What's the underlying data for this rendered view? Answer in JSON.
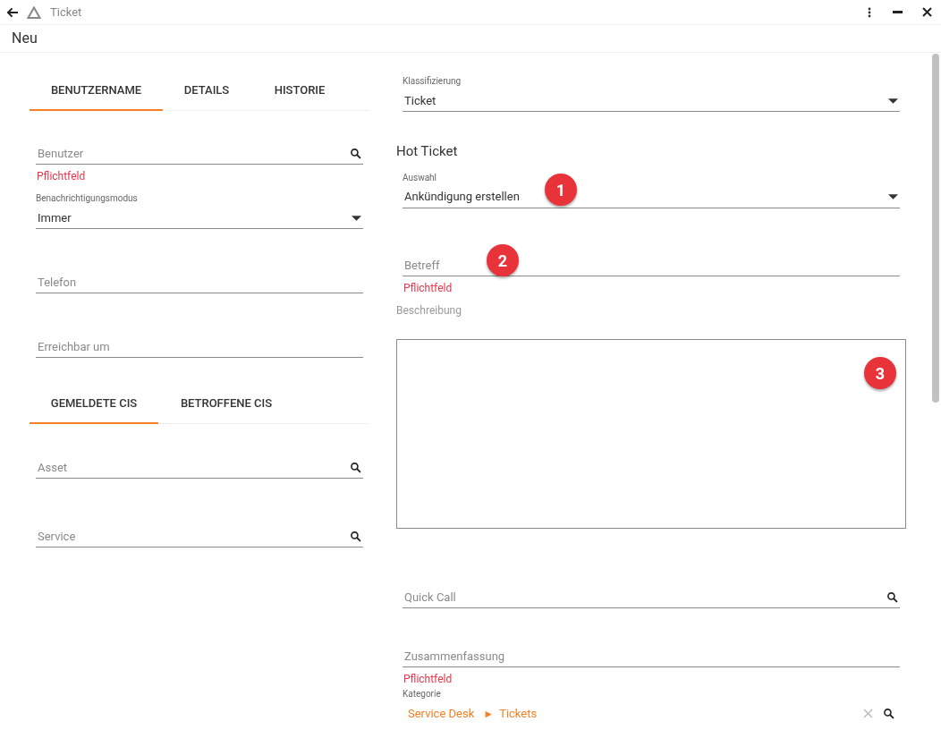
{
  "window": {
    "title": "Ticket"
  },
  "header": {
    "title": "Neu"
  },
  "left": {
    "tabs": [
      {
        "label": "BENUTZERNAME",
        "selected": true
      },
      {
        "label": "DETAILS",
        "selected": false
      },
      {
        "label": "HISTORIE",
        "selected": false
      }
    ],
    "fields": [
      {
        "kind": "search",
        "placeholder": "Benutzer",
        "error": "Pflichtfeld"
      },
      {
        "kind": "select",
        "label": "Benachrichtigungsmodus",
        "value": "Immer"
      },
      {
        "kind": "text",
        "placeholder": "Telefon"
      },
      {
        "kind": "text",
        "placeholder": "Erreichbar um"
      }
    ],
    "ci_tabs": [
      {
        "label": "GEMELDETE CIS",
        "selected": true
      },
      {
        "label": "BETROFFENE CIS",
        "selected": false
      }
    ],
    "ci_fields": [
      {
        "kind": "search",
        "placeholder": "Asset"
      },
      {
        "kind": "search",
        "placeholder": "Service"
      }
    ]
  },
  "right": {
    "classification": {
      "label": "Klassifizierung",
      "value": "Ticket"
    },
    "section_title": "Hot Ticket",
    "selection": {
      "label": "Auswahl",
      "value": "Ankündigung erstellen"
    },
    "subject": {
      "placeholder": "Betreff",
      "error": "Pflichtfeld"
    },
    "description": {
      "label": "Beschreibung"
    },
    "quick_call": {
      "placeholder": "Quick Call"
    },
    "summary": {
      "placeholder": "Zusammenfassung",
      "error": "Pflichtfeld"
    },
    "category": {
      "label": "Kategorie",
      "path": [
        "Service Desk",
        "Tickets"
      ],
      "separator": "►"
    }
  },
  "markers": [
    {
      "label": "1"
    },
    {
      "label": "2"
    },
    {
      "label": "3"
    }
  ]
}
